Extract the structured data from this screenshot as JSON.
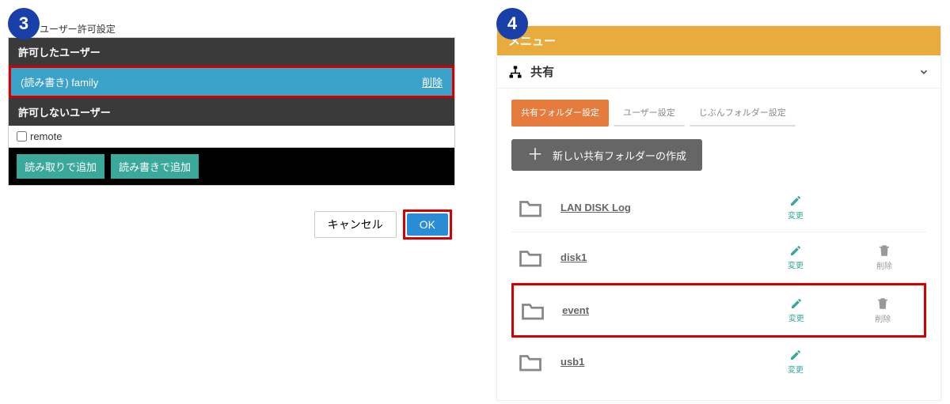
{
  "left": {
    "step": "3",
    "section_title": "ユーザー許可設定",
    "allowed_header": "許可したユーザー",
    "allowed_user": "(読み書き) family",
    "delete_link": "削除",
    "denied_header": "許可しないユーザー",
    "denied_user": "remote",
    "btn_add_readonly": "読み取りで追加",
    "btn_add_readwrite": "読み書きで追加",
    "btn_cancel": "キャンセル",
    "btn_ok": "OK"
  },
  "right": {
    "step": "4",
    "menu_title": "メニュー",
    "share_title": "共有",
    "tabs": {
      "t1": "共有フォルダー設定",
      "t2": "ユーザー設定",
      "t3": "じぶんフォルダー設定"
    },
    "new_folder": "新しい共有フォルダーの作成",
    "action_change": "変更",
    "action_delete": "削除",
    "folders": {
      "f1": "LAN DISK Log",
      "f2": "disk1",
      "f3": "event",
      "f4": "usb1"
    }
  }
}
